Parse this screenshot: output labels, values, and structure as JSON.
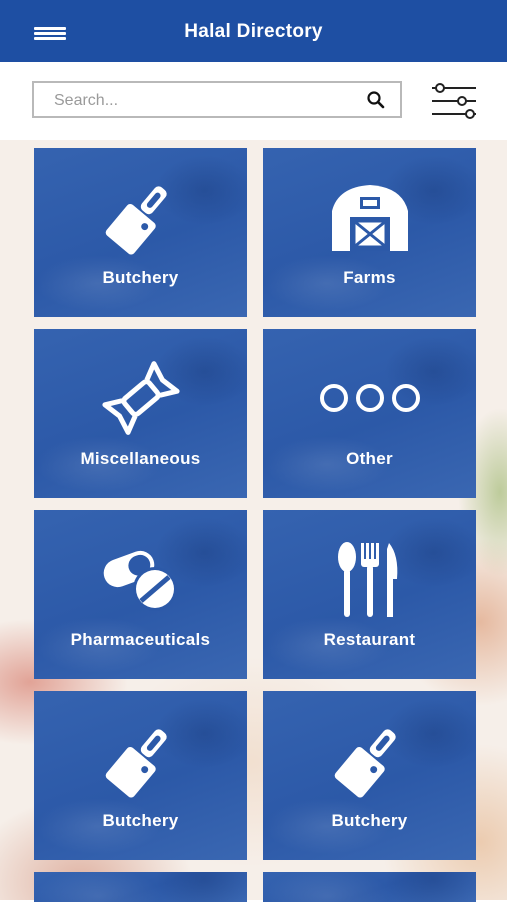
{
  "header": {
    "title": "Halal Directory",
    "menu_icon": "hamburger-icon"
  },
  "search": {
    "placeholder": "Search...",
    "value": "",
    "icon": "search-icon",
    "filter_icon": "filter-sliders-icon"
  },
  "colors": {
    "primary": "#1e4fa3",
    "tile": "#2c59a8",
    "text_on_primary": "#ffffff"
  },
  "categories": [
    {
      "label": "Butchery",
      "icon": "cleaver-icon"
    },
    {
      "label": "Farms",
      "icon": "barn-icon"
    },
    {
      "label": "Miscellaneous",
      "icon": "candy-icon"
    },
    {
      "label": "Other",
      "icon": "three-circles-icon"
    },
    {
      "label": "Pharmaceuticals",
      "icon": "pills-icon"
    },
    {
      "label": "Restaurant",
      "icon": "cutlery-icon"
    },
    {
      "label": "Butchery",
      "icon": "cleaver-icon"
    },
    {
      "label": "Butchery",
      "icon": "cleaver-icon"
    }
  ]
}
